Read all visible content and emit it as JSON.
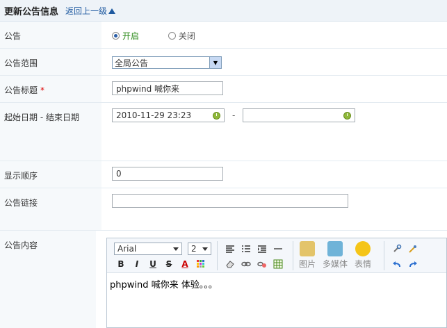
{
  "header": {
    "title": "更新公告信息",
    "back_label": "返回上一级"
  },
  "status": {
    "label": "公告",
    "on_label": "开启",
    "off_label": "关闭",
    "selected": "开启"
  },
  "scope": {
    "label": "公告范围",
    "value": "全局公告"
  },
  "title_field": {
    "label": "公告标题",
    "required_mark": "*",
    "value": "phpwind 喊你来"
  },
  "dates": {
    "label": "起始日期 - 结束日期",
    "start": "2010-11-29 23:23",
    "separator": "-",
    "end": ""
  },
  "order": {
    "label": "显示顺序",
    "value": "0"
  },
  "link": {
    "label": "公告链接",
    "value": ""
  },
  "body": {
    "label": "公告内容",
    "font": "Arial",
    "size": "2",
    "buttons": {
      "bold": "B",
      "italic": "I",
      "underline": "U",
      "strike": "S",
      "color": "A"
    },
    "big_buttons": {
      "image": "图片",
      "media": "多媒体",
      "emoji": "表情"
    },
    "content": "phpwind 喊你来 体验。。。"
  }
}
